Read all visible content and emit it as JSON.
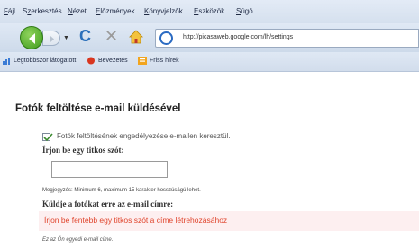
{
  "menu": {
    "items": [
      {
        "prefix": "",
        "mnemonic": "F",
        "rest": "ájl"
      },
      {
        "prefix": "S",
        "mnemonic": "z",
        "rest": "erkesztés"
      },
      {
        "prefix": "",
        "mnemonic": "N",
        "rest": "ézet"
      },
      {
        "prefix": "",
        "mnemonic": "E",
        "rest": "lőzmények"
      },
      {
        "prefix": "",
        "mnemonic": "K",
        "rest": "önyvjelzők"
      },
      {
        "prefix": "",
        "mnemonic": "E",
        "rest": "szközök"
      },
      {
        "prefix": "",
        "mnemonic": "S",
        "rest": "úgó"
      }
    ]
  },
  "toolbar": {
    "url": "http://picasaweb.google.com/lh/settings",
    "icons": [
      "back-icon",
      "forward-icon",
      "reload-icon",
      "stop-icon",
      "home-icon",
      "site-icon"
    ]
  },
  "bookmarks": {
    "items": [
      "Legtöbbször látogatott",
      "Bevezetés",
      "Friss hírek"
    ]
  },
  "page": {
    "heading": "Fotók feltöltése e-mail küldésével",
    "enable_label": "Fotók feltöltésének engedélyezése e-mailen keresztül.",
    "enable_checked": true,
    "secret_label": "Írjon be egy titkos szót:",
    "secret_value": "",
    "hint": "Megjegyzés: Minimum 6, maximum 15 karakter hosszúságú lehet.",
    "send_label": "Küldje a fotókat erre az e-mail címre:",
    "notice": "Írjon be fentebb egy titkos szót a címe létrehozásához",
    "footer_note": "Ez az Ön egyedi e-mail címe."
  },
  "colors": {
    "notice_text": "#e0442c",
    "notice_bg": "#fdeff0",
    "chrome": "#d5e0ee"
  }
}
